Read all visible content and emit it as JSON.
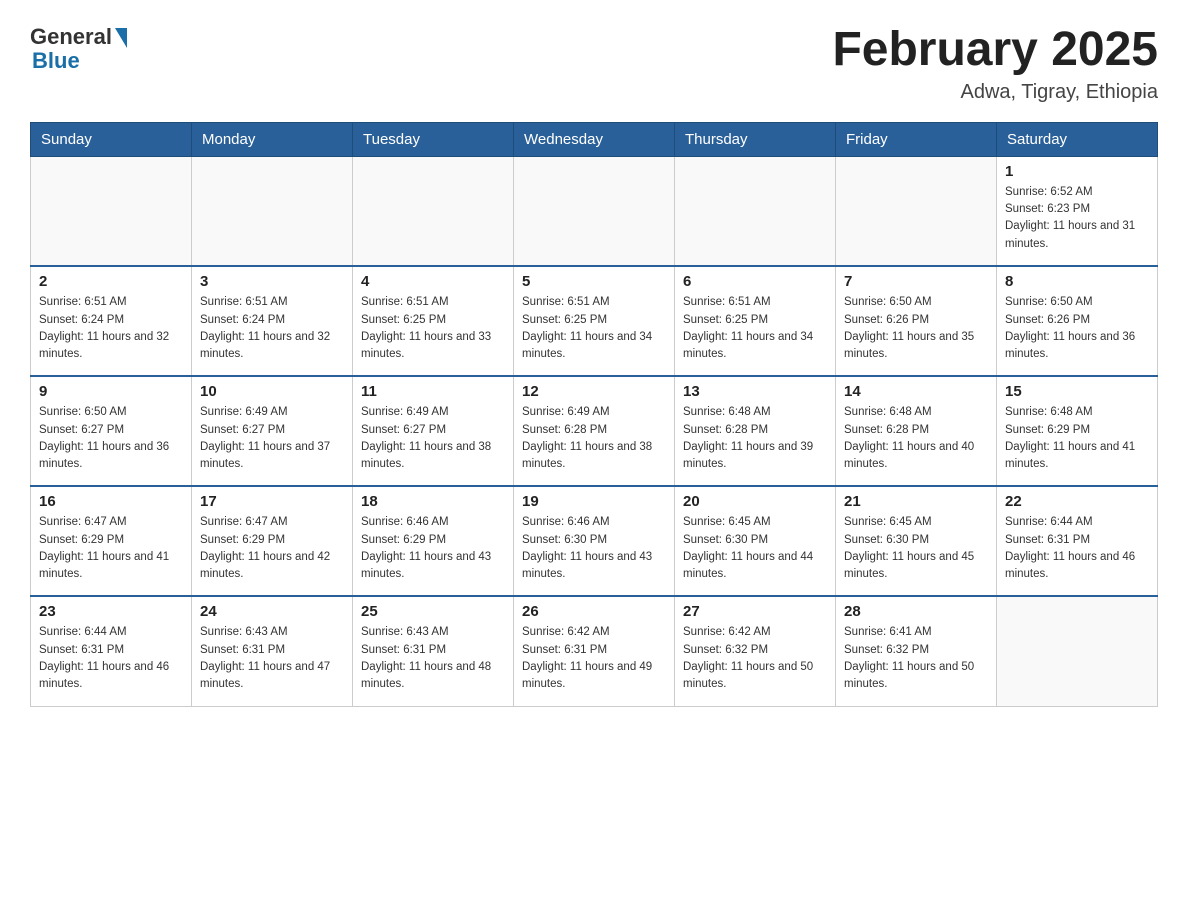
{
  "header": {
    "logo_general": "General",
    "logo_blue": "Blue",
    "main_title": "February 2025",
    "subtitle": "Adwa, Tigray, Ethiopia"
  },
  "days_of_week": [
    "Sunday",
    "Monday",
    "Tuesday",
    "Wednesday",
    "Thursday",
    "Friday",
    "Saturday"
  ],
  "weeks": [
    [
      {
        "day": "",
        "sunrise": "",
        "sunset": "",
        "daylight": ""
      },
      {
        "day": "",
        "sunrise": "",
        "sunset": "",
        "daylight": ""
      },
      {
        "day": "",
        "sunrise": "",
        "sunset": "",
        "daylight": ""
      },
      {
        "day": "",
        "sunrise": "",
        "sunset": "",
        "daylight": ""
      },
      {
        "day": "",
        "sunrise": "",
        "sunset": "",
        "daylight": ""
      },
      {
        "day": "",
        "sunrise": "",
        "sunset": "",
        "daylight": ""
      },
      {
        "day": "1",
        "sunrise": "Sunrise: 6:52 AM",
        "sunset": "Sunset: 6:23 PM",
        "daylight": "Daylight: 11 hours and 31 minutes."
      }
    ],
    [
      {
        "day": "2",
        "sunrise": "Sunrise: 6:51 AM",
        "sunset": "Sunset: 6:24 PM",
        "daylight": "Daylight: 11 hours and 32 minutes."
      },
      {
        "day": "3",
        "sunrise": "Sunrise: 6:51 AM",
        "sunset": "Sunset: 6:24 PM",
        "daylight": "Daylight: 11 hours and 32 minutes."
      },
      {
        "day": "4",
        "sunrise": "Sunrise: 6:51 AM",
        "sunset": "Sunset: 6:25 PM",
        "daylight": "Daylight: 11 hours and 33 minutes."
      },
      {
        "day": "5",
        "sunrise": "Sunrise: 6:51 AM",
        "sunset": "Sunset: 6:25 PM",
        "daylight": "Daylight: 11 hours and 34 minutes."
      },
      {
        "day": "6",
        "sunrise": "Sunrise: 6:51 AM",
        "sunset": "Sunset: 6:25 PM",
        "daylight": "Daylight: 11 hours and 34 minutes."
      },
      {
        "day": "7",
        "sunrise": "Sunrise: 6:50 AM",
        "sunset": "Sunset: 6:26 PM",
        "daylight": "Daylight: 11 hours and 35 minutes."
      },
      {
        "day": "8",
        "sunrise": "Sunrise: 6:50 AM",
        "sunset": "Sunset: 6:26 PM",
        "daylight": "Daylight: 11 hours and 36 minutes."
      }
    ],
    [
      {
        "day": "9",
        "sunrise": "Sunrise: 6:50 AM",
        "sunset": "Sunset: 6:27 PM",
        "daylight": "Daylight: 11 hours and 36 minutes."
      },
      {
        "day": "10",
        "sunrise": "Sunrise: 6:49 AM",
        "sunset": "Sunset: 6:27 PM",
        "daylight": "Daylight: 11 hours and 37 minutes."
      },
      {
        "day": "11",
        "sunrise": "Sunrise: 6:49 AM",
        "sunset": "Sunset: 6:27 PM",
        "daylight": "Daylight: 11 hours and 38 minutes."
      },
      {
        "day": "12",
        "sunrise": "Sunrise: 6:49 AM",
        "sunset": "Sunset: 6:28 PM",
        "daylight": "Daylight: 11 hours and 38 minutes."
      },
      {
        "day": "13",
        "sunrise": "Sunrise: 6:48 AM",
        "sunset": "Sunset: 6:28 PM",
        "daylight": "Daylight: 11 hours and 39 minutes."
      },
      {
        "day": "14",
        "sunrise": "Sunrise: 6:48 AM",
        "sunset": "Sunset: 6:28 PM",
        "daylight": "Daylight: 11 hours and 40 minutes."
      },
      {
        "day": "15",
        "sunrise": "Sunrise: 6:48 AM",
        "sunset": "Sunset: 6:29 PM",
        "daylight": "Daylight: 11 hours and 41 minutes."
      }
    ],
    [
      {
        "day": "16",
        "sunrise": "Sunrise: 6:47 AM",
        "sunset": "Sunset: 6:29 PM",
        "daylight": "Daylight: 11 hours and 41 minutes."
      },
      {
        "day": "17",
        "sunrise": "Sunrise: 6:47 AM",
        "sunset": "Sunset: 6:29 PM",
        "daylight": "Daylight: 11 hours and 42 minutes."
      },
      {
        "day": "18",
        "sunrise": "Sunrise: 6:46 AM",
        "sunset": "Sunset: 6:29 PM",
        "daylight": "Daylight: 11 hours and 43 minutes."
      },
      {
        "day": "19",
        "sunrise": "Sunrise: 6:46 AM",
        "sunset": "Sunset: 6:30 PM",
        "daylight": "Daylight: 11 hours and 43 minutes."
      },
      {
        "day": "20",
        "sunrise": "Sunrise: 6:45 AM",
        "sunset": "Sunset: 6:30 PM",
        "daylight": "Daylight: 11 hours and 44 minutes."
      },
      {
        "day": "21",
        "sunrise": "Sunrise: 6:45 AM",
        "sunset": "Sunset: 6:30 PM",
        "daylight": "Daylight: 11 hours and 45 minutes."
      },
      {
        "day": "22",
        "sunrise": "Sunrise: 6:44 AM",
        "sunset": "Sunset: 6:31 PM",
        "daylight": "Daylight: 11 hours and 46 minutes."
      }
    ],
    [
      {
        "day": "23",
        "sunrise": "Sunrise: 6:44 AM",
        "sunset": "Sunset: 6:31 PM",
        "daylight": "Daylight: 11 hours and 46 minutes."
      },
      {
        "day": "24",
        "sunrise": "Sunrise: 6:43 AM",
        "sunset": "Sunset: 6:31 PM",
        "daylight": "Daylight: 11 hours and 47 minutes."
      },
      {
        "day": "25",
        "sunrise": "Sunrise: 6:43 AM",
        "sunset": "Sunset: 6:31 PM",
        "daylight": "Daylight: 11 hours and 48 minutes."
      },
      {
        "day": "26",
        "sunrise": "Sunrise: 6:42 AM",
        "sunset": "Sunset: 6:31 PM",
        "daylight": "Daylight: 11 hours and 49 minutes."
      },
      {
        "day": "27",
        "sunrise": "Sunrise: 6:42 AM",
        "sunset": "Sunset: 6:32 PM",
        "daylight": "Daylight: 11 hours and 50 minutes."
      },
      {
        "day": "28",
        "sunrise": "Sunrise: 6:41 AM",
        "sunset": "Sunset: 6:32 PM",
        "daylight": "Daylight: 11 hours and 50 minutes."
      },
      {
        "day": "",
        "sunrise": "",
        "sunset": "",
        "daylight": ""
      }
    ]
  ]
}
